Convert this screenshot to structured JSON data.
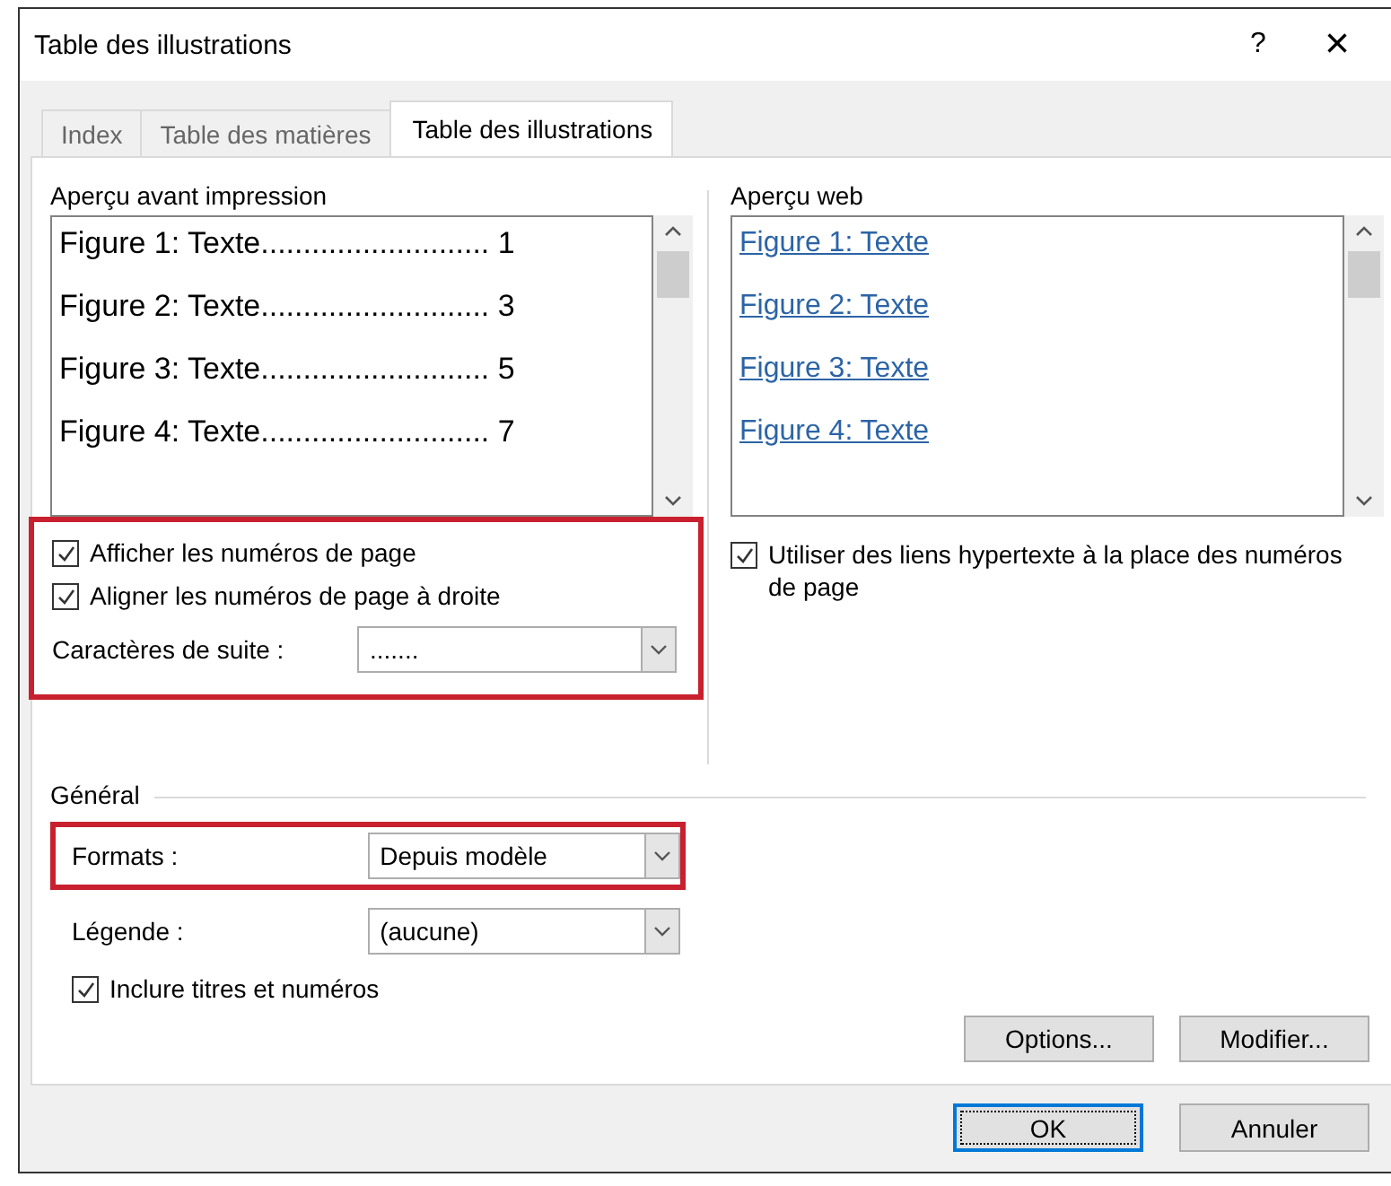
{
  "window": {
    "title": "Table des illustrations",
    "help": "?",
    "close": "×"
  },
  "tabs": [
    {
      "label": "Index",
      "selected": false
    },
    {
      "label": "Table des matières",
      "selected": false
    },
    {
      "label": "Table des illustrations",
      "selected": true
    }
  ],
  "print_preview": {
    "label": "Aperçu avant impression",
    "entries": [
      {
        "text": "Figure 1: Texte",
        "leader": "...........................",
        "page": "1"
      },
      {
        "text": "Figure 2: Texte",
        "leader": "...........................",
        "page": "3"
      },
      {
        "text": "Figure 3: Texte",
        "leader": "...........................",
        "page": "5"
      },
      {
        "text": "Figure 4: Texte",
        "leader": "...........................",
        "page": "7"
      }
    ]
  },
  "print_options": {
    "highlighted": true,
    "checkboxes": [
      {
        "label": "Afficher les numéros de page",
        "checked": true
      },
      {
        "label": "Aligner les numéros de page à droite",
        "checked": true
      }
    ],
    "leader_label": "Caractères de suite :",
    "leader_value": "......."
  },
  "web_preview": {
    "label": "Aperçu web",
    "links": [
      "Figure 1: Texte",
      "Figure 2: Texte",
      "Figure 3: Texte",
      "Figure 4: Texte"
    ],
    "checkbox": {
      "label": "Utiliser des liens hypertexte à la place des numéros de page",
      "checked": true
    }
  },
  "general": {
    "label": "Général",
    "rows": [
      {
        "label": "Formats :",
        "value": "Depuis modèle",
        "highlighted": true
      },
      {
        "label": "Légende :",
        "value": "(aucune)",
        "highlighted": false
      }
    ],
    "checkbox": {
      "label": "Inclure titres et numéros",
      "checked": true
    }
  },
  "panel_buttons": [
    "Options...",
    "Modifier..."
  ],
  "buttons": [
    {
      "label": "OK",
      "default": true
    },
    {
      "label": "Annuler",
      "default": false
    }
  ]
}
